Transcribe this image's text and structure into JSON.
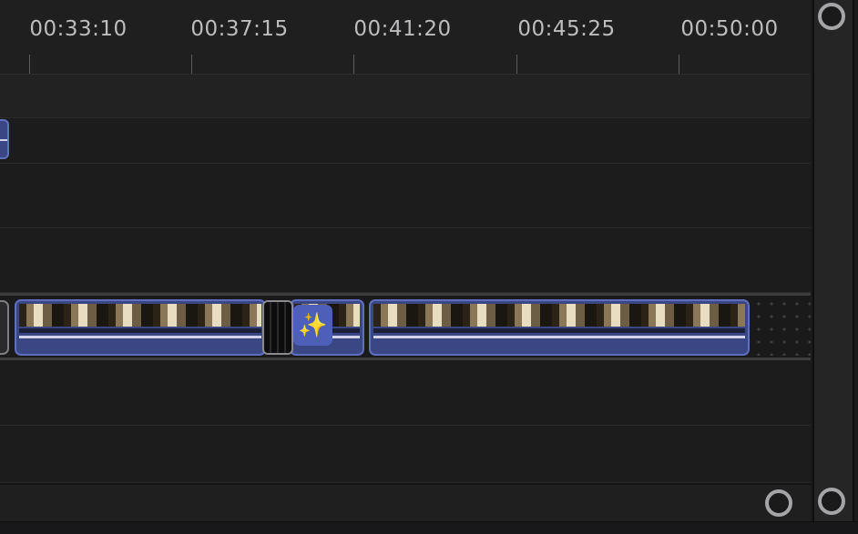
{
  "ruler": {
    "ticks": [
      {
        "label": "00:33:10"
      },
      {
        "label": "00:37:15"
      },
      {
        "label": "00:41:20"
      },
      {
        "label": "00:45:25"
      },
      {
        "label": "00:50:00"
      }
    ]
  },
  "transition": {
    "icon": "sparkles-icon",
    "glyph": "✨"
  },
  "colors": {
    "clip_border": "#5e6fbe",
    "clip_fill": "#3a4784",
    "background": "#1e1e1f",
    "fx_badge": "#4d5fb8",
    "fx_icon": "#f5d23a"
  }
}
